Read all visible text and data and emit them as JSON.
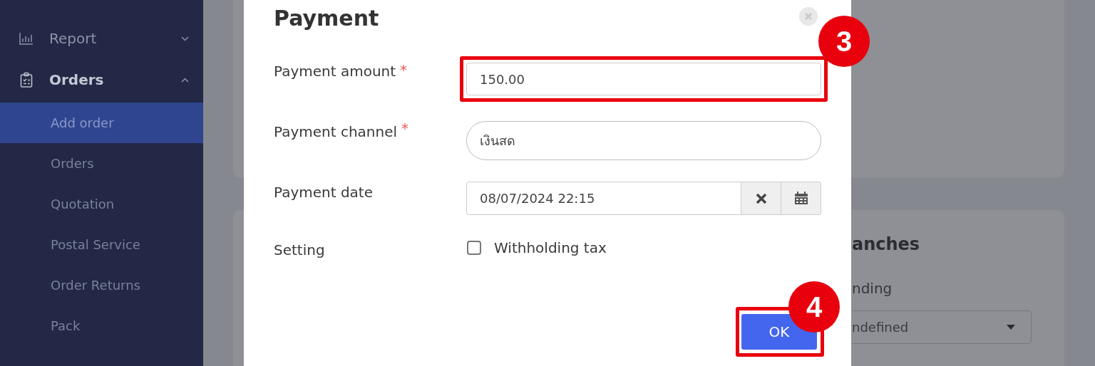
{
  "sidebar": {
    "items": [
      {
        "label": "Report",
        "kind": "chart",
        "expanded": false
      },
      {
        "label": "Orders",
        "kind": "clipboard",
        "expanded": true,
        "children": [
          {
            "label": "Add order",
            "selected": true
          },
          {
            "label": "Orders",
            "selected": false
          },
          {
            "label": "Quotation",
            "selected": false
          },
          {
            "label": "Postal Service",
            "selected": false
          },
          {
            "label": "Order Returns",
            "selected": false
          },
          {
            "label": "Pack",
            "selected": false
          }
        ]
      }
    ]
  },
  "background_card": {
    "title": "anches",
    "field_label": "nding",
    "select_value": "ndefined"
  },
  "dialog": {
    "title": "Payment",
    "fields": [
      {
        "kind": "text",
        "label": "Payment amount",
        "required_mark": "*",
        "value": "150.00",
        "annotation": "3"
      },
      {
        "kind": "select",
        "label": "Payment channel",
        "required_mark": "*",
        "value": "เงินสด"
      },
      {
        "kind": "date",
        "label": "Payment date",
        "value": "08/07/2024 22:15"
      },
      {
        "kind": "checkbox",
        "label": "Setting",
        "option": "Withholding tax",
        "checked": false
      }
    ],
    "buttons": [
      {
        "label": "OK",
        "annotation": "4"
      }
    ]
  }
}
